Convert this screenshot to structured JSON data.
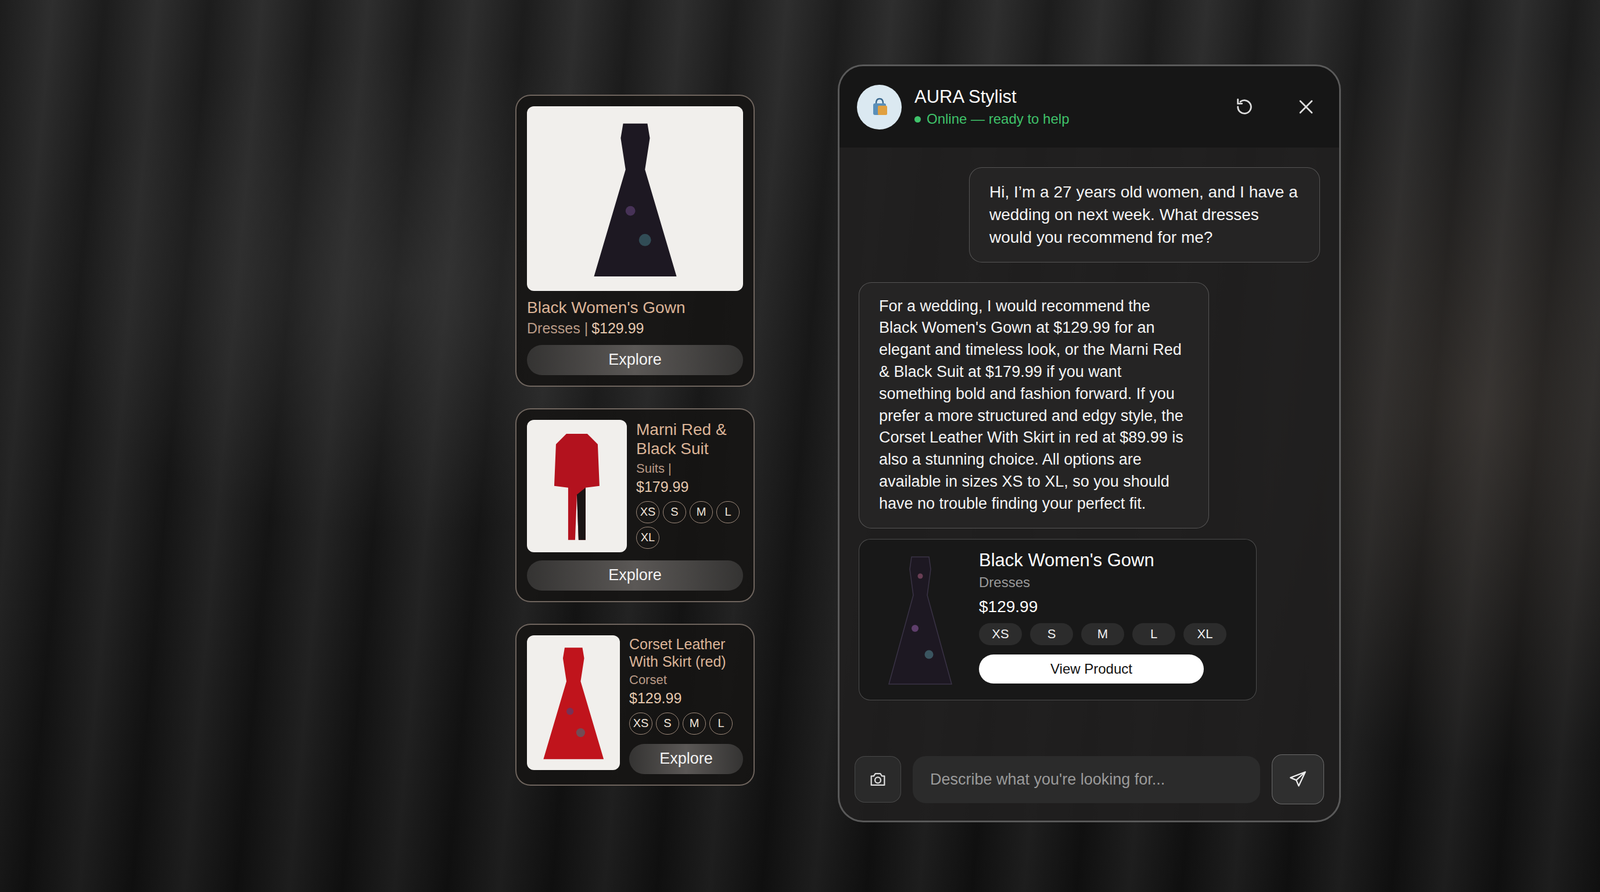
{
  "side_products": [
    {
      "kind": "hero",
      "name": "Black Women's Gown",
      "category": "Dresses |",
      "price": "$129.99",
      "sizes": [],
      "color": "#1d1822",
      "action": "Explore"
    },
    {
      "kind": "wide",
      "name": "Marni Red & Black Suit",
      "category": "Suits |",
      "price": "$179.99",
      "sizes": [
        "XS",
        "S",
        "M",
        "L",
        "XL"
      ],
      "color": "#b3121e",
      "action": "Explore"
    },
    {
      "kind": "compact",
      "name": "Corset Leather With Skirt (red)",
      "category": "Corset",
      "price": "$129.99",
      "sizes": [
        "XS",
        "S",
        "M",
        "L"
      ],
      "color": "#c0141c",
      "action": "Explore"
    }
  ],
  "chat": {
    "title": "AURA Stylist",
    "status": "Online — ready to help",
    "online": true,
    "messages": [
      {
        "role": "user",
        "text": "Hi, I’m a 27 years old women, and I have a wedding on next week. What dresses would you recommend for me?"
      },
      {
        "role": "assistant",
        "text": "For a wedding, I would recommend the Black Women's Gown at $129.99 for an elegant and timeless look, or the Marni Red & Black Suit at $179.99 if you want something bold and fashion forward. If you prefer a more structured and edgy style, the Corset Leather With Skirt in red at $89.99 is also a stunning choice. All options are available in sizes XS to XL, so you should have no trouble finding your perfect fit."
      }
    ],
    "product": {
      "name": "Black Women's Gown",
      "category": "Dresses",
      "price": "$129.99",
      "sizes": [
        "XS",
        "S",
        "M",
        "L",
        "XL"
      ],
      "color": "#1d1822",
      "action": "View Product"
    },
    "input": {
      "placeholder": "Describe what you're looking for..."
    }
  }
}
